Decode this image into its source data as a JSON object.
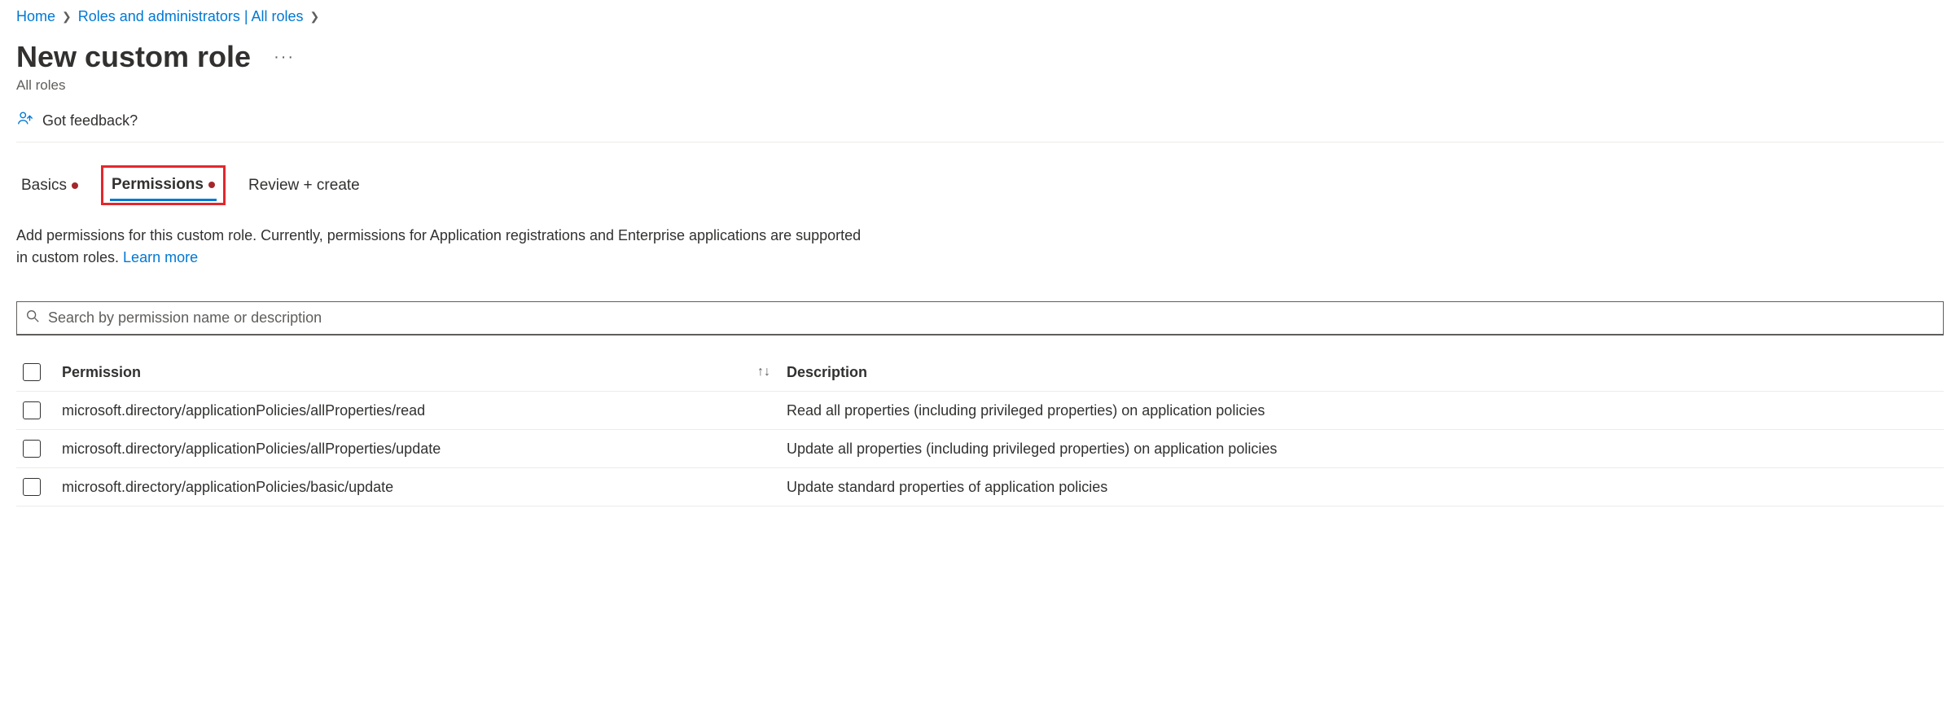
{
  "breadcrumb": {
    "home": "Home",
    "roles": "Roles and administrators | All roles"
  },
  "page": {
    "title": "New custom role",
    "subtitle": "All roles"
  },
  "feedback": {
    "label": "Got feedback?"
  },
  "tabs": {
    "basics": "Basics",
    "permissions": "Permissions",
    "review": "Review + create"
  },
  "description": {
    "text1": "Add permissions for this custom role. Currently, permissions for Application registrations and Enterprise applications are supported",
    "text2": "in custom roles. ",
    "learn_more": "Learn more"
  },
  "search": {
    "placeholder": "Search by permission name or description"
  },
  "table": {
    "header_permission": "Permission",
    "header_description": "Description",
    "rows": [
      {
        "permission": "microsoft.directory/applicationPolicies/allProperties/read",
        "description": "Read all properties (including privileged properties) on application policies"
      },
      {
        "permission": "microsoft.directory/applicationPolicies/allProperties/update",
        "description": "Update all properties (including privileged properties) on application policies"
      },
      {
        "permission": "microsoft.directory/applicationPolicies/basic/update",
        "description": "Update standard properties of application policies"
      }
    ]
  }
}
